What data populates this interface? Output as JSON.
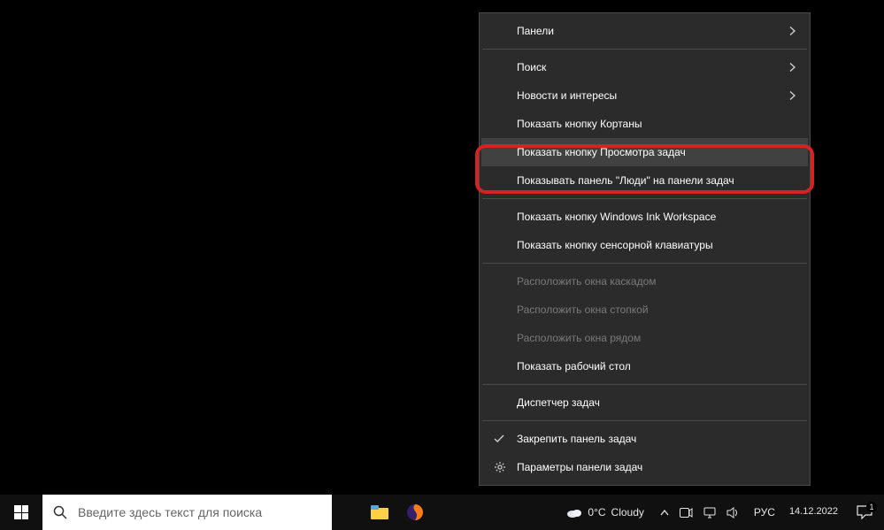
{
  "menu": {
    "panels": "Панели",
    "search": "Поиск",
    "news": "Новости и интересы",
    "cortana": "Показать кнопку Кортаны",
    "taskview": "Показать кнопку Просмотра задач",
    "people": "Показывать панель \"Люди\" на панели задач",
    "ink": "Показать кнопку Windows Ink Workspace",
    "touchkb": "Показать кнопку сенсорной клавиатуры",
    "cascade": "Расположить окна каскадом",
    "stacked": "Расположить окна стопкой",
    "sidebyside": "Расположить окна рядом",
    "desktop": "Показать рабочий стол",
    "taskmgr": "Диспетчер задач",
    "lock": "Закрепить панель задач",
    "settings": "Параметры панели задач"
  },
  "taskbar": {
    "search_placeholder": "Введите здесь текст для поиска",
    "weather_temp": "0°C",
    "weather_text": "Cloudy",
    "lang": "РУС",
    "date": "14.12.2022",
    "notif_count": "1"
  }
}
